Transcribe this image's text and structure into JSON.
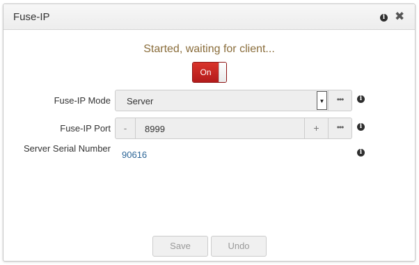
{
  "dialog": {
    "title": "Fuse-IP",
    "info_icon": "info-circle",
    "close_icon": "close-x"
  },
  "status": {
    "text": "Started, waiting for client...",
    "color": "#8a6d3b"
  },
  "toggle": {
    "label": "On",
    "state": "on",
    "color": "#c9231f"
  },
  "fields": {
    "mode": {
      "label": "Fuse-IP Mode",
      "value": "Server",
      "more_label": "•••"
    },
    "port": {
      "label": "Fuse-IP Port",
      "value": "8999",
      "minus_label": "-",
      "plus_label": "+",
      "more_label": "•••"
    },
    "serial": {
      "label": "Server Serial Number",
      "value": "90616",
      "color": "#2a6496"
    }
  },
  "footer": {
    "save_label": "Save",
    "undo_label": "Undo"
  }
}
